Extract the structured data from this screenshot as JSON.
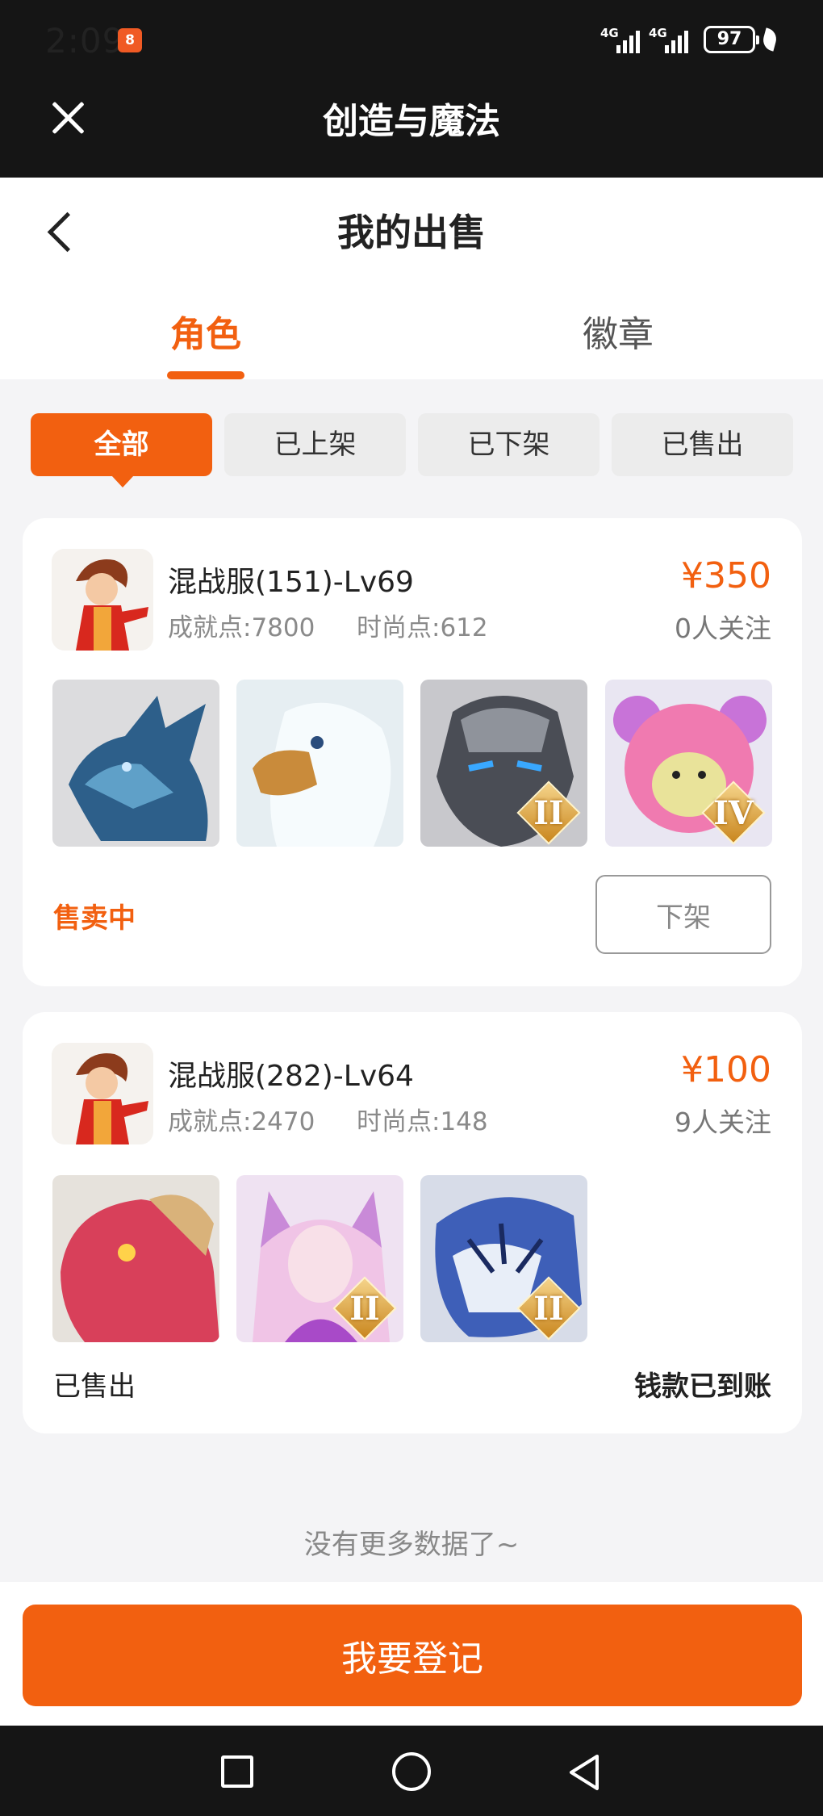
{
  "status_bar": {
    "time": "2:09",
    "app_badge": "8",
    "signal_1": "4G",
    "signal_2": "4G",
    "battery": "97"
  },
  "app_bar": {
    "title": "创造与魔法"
  },
  "page": {
    "title": "我的出售"
  },
  "tabs": [
    {
      "label": "角色"
    },
    {
      "label": "徽章"
    }
  ],
  "filters": [
    {
      "label": "全部"
    },
    {
      "label": "已上架"
    },
    {
      "label": "已下架"
    },
    {
      "label": "已售出"
    }
  ],
  "listings": [
    {
      "title": "混战服(151)-Lv69",
      "achievement": "成就点:7800",
      "fashion": "时尚点:612",
      "price": "¥350",
      "watchers": "0人关注",
      "thumbs": [
        {
          "name": "ice-dragon-thumb",
          "badge": ""
        },
        {
          "name": "white-eagle-thumb",
          "badge": ""
        },
        {
          "name": "stone-golem-thumb",
          "badge": "II"
        },
        {
          "name": "pink-bear-thumb",
          "badge": "IV"
        }
      ],
      "status": "售卖中",
      "action": "下架"
    },
    {
      "title": "混战服(282)-Lv64",
      "achievement": "成就点:2470",
      "fashion": "时尚点:148",
      "price": "¥100",
      "watchers": "9人关注",
      "thumbs": [
        {
          "name": "red-dragon-thumb",
          "badge": ""
        },
        {
          "name": "fox-fairy-thumb",
          "badge": "II"
        },
        {
          "name": "blue-tiger-thumb",
          "badge": "II"
        }
      ],
      "status": "已售出",
      "note": "钱款已到账"
    }
  ],
  "footer": {
    "no_more": "没有更多数据了~",
    "register_button": "我要登记"
  },
  "colors": {
    "accent": "#f26010",
    "dark_bar": "#151515",
    "page_bg": "#f4f4f6"
  }
}
